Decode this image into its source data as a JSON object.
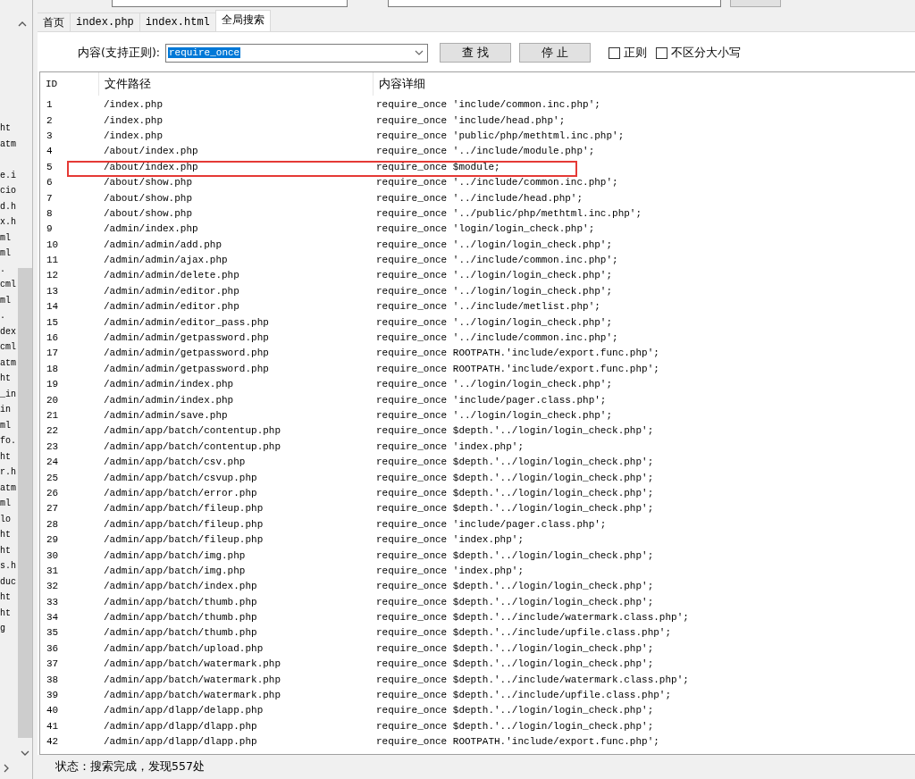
{
  "left_panel": {
    "items": [
      {
        "text": "ht"
      },
      {
        "text": "atm"
      },
      {
        "text": "e.i"
      },
      {
        "text": "cio"
      },
      {
        "text": "d.h"
      },
      {
        "text": "x.h"
      },
      {
        "text": "ml"
      },
      {
        "text": "ml"
      },
      {
        "text": "."
      },
      {
        "text": "cml"
      },
      {
        "text": "ml"
      },
      {
        "text": "."
      },
      {
        "text": "dex"
      },
      {
        "text": "cml"
      },
      {
        "text": "atm"
      },
      {
        "text": "ht"
      },
      {
        "text": "_in"
      },
      {
        "text": "in"
      },
      {
        "text": "ml"
      },
      {
        "text": "fo."
      },
      {
        "text": "ht"
      },
      {
        "text": "r.h"
      },
      {
        "text": "atm"
      },
      {
        "text": "ml"
      },
      {
        "text": "lo"
      },
      {
        "text": "ht"
      },
      {
        "text": "ht"
      },
      {
        "text": "s.h"
      },
      {
        "text": "duc"
      },
      {
        "text": "ht"
      },
      {
        "text": "ht"
      },
      {
        "text": "g"
      }
    ]
  },
  "tabs": [
    {
      "label": "首页",
      "selected": false
    },
    {
      "label": "index.php",
      "selected": false
    },
    {
      "label": "index.html",
      "selected": false
    },
    {
      "label": "全局搜索",
      "selected": true
    }
  ],
  "search": {
    "label": "内容(支持正则):",
    "value": "require_once",
    "buttons": [
      "查 找",
      "停 止"
    ],
    "options": [
      {
        "label": "正则",
        "checked": false
      },
      {
        "label": "不区分大小写",
        "checked": false
      }
    ]
  },
  "table": {
    "columns": [
      "ID",
      "文件路径",
      "内容详细"
    ],
    "rows": [
      {
        "id": "1",
        "path": "/index.php",
        "detail": "require_once 'include/common.inc.php';",
        "highlighted": false
      },
      {
        "id": "2",
        "path": "/index.php",
        "detail": "require_once 'include/head.php';",
        "highlighted": false
      },
      {
        "id": "3",
        "path": "/index.php",
        "detail": "require_once 'public/php/methtml.inc.php';",
        "highlighted": false
      },
      {
        "id": "4",
        "path": "/about/index.php",
        "detail": "require_once '../include/module.php';",
        "highlighted": false
      },
      {
        "id": "5",
        "path": "/about/index.php",
        "detail": "require_once $module;",
        "highlighted": true
      },
      {
        "id": "6",
        "path": "/about/show.php",
        "detail": "require_once '../include/common.inc.php';",
        "highlighted": false
      },
      {
        "id": "7",
        "path": "/about/show.php",
        "detail": "require_once '../include/head.php';",
        "highlighted": false
      },
      {
        "id": "8",
        "path": "/about/show.php",
        "detail": "require_once '../public/php/methtml.inc.php';",
        "highlighted": false
      },
      {
        "id": "9",
        "path": "/admin/index.php",
        "detail": "require_once 'login/login_check.php';",
        "highlighted": false
      },
      {
        "id": "10",
        "path": "/admin/admin/add.php",
        "detail": "require_once '../login/login_check.php';",
        "highlighted": false
      },
      {
        "id": "11",
        "path": "/admin/admin/ajax.php",
        "detail": "require_once '../include/common.inc.php';",
        "highlighted": false
      },
      {
        "id": "12",
        "path": "/admin/admin/delete.php",
        "detail": "require_once '../login/login_check.php';",
        "highlighted": false
      },
      {
        "id": "13",
        "path": "/admin/admin/editor.php",
        "detail": "require_once '../login/login_check.php';",
        "highlighted": false
      },
      {
        "id": "14",
        "path": "/admin/admin/editor.php",
        "detail": "require_once '../include/metlist.php';",
        "highlighted": false
      },
      {
        "id": "15",
        "path": "/admin/admin/editor_pass.php",
        "detail": "require_once '../login/login_check.php';",
        "highlighted": false
      },
      {
        "id": "16",
        "path": "/admin/admin/getpassword.php",
        "detail": "require_once '../include/common.inc.php';",
        "highlighted": false
      },
      {
        "id": "17",
        "path": "/admin/admin/getpassword.php",
        "detail": "require_once ROOTPATH.'include/export.func.php';",
        "highlighted": false
      },
      {
        "id": "18",
        "path": "/admin/admin/getpassword.php",
        "detail": "require_once ROOTPATH.'include/export.func.php';",
        "highlighted": false
      },
      {
        "id": "19",
        "path": "/admin/admin/index.php",
        "detail": "require_once '../login/login_check.php';",
        "highlighted": false
      },
      {
        "id": "20",
        "path": "/admin/admin/index.php",
        "detail": "require_once 'include/pager.class.php';",
        "highlighted": false
      },
      {
        "id": "21",
        "path": "/admin/admin/save.php",
        "detail": "require_once '../login/login_check.php';",
        "highlighted": false
      },
      {
        "id": "22",
        "path": "/admin/app/batch/contentup.php",
        "detail": "require_once $depth.'../login/login_check.php';",
        "highlighted": false
      },
      {
        "id": "23",
        "path": "/admin/app/batch/contentup.php",
        "detail": "require_once 'index.php';",
        "highlighted": false
      },
      {
        "id": "24",
        "path": "/admin/app/batch/csv.php",
        "detail": "require_once $depth.'../login/login_check.php';",
        "highlighted": false
      },
      {
        "id": "25",
        "path": "/admin/app/batch/csvup.php",
        "detail": "require_once $depth.'../login/login_check.php';",
        "highlighted": false
      },
      {
        "id": "26",
        "path": "/admin/app/batch/error.php",
        "detail": "require_once $depth.'../login/login_check.php';",
        "highlighted": false
      },
      {
        "id": "27",
        "path": "/admin/app/batch/fileup.php",
        "detail": "require_once $depth.'../login/login_check.php';",
        "highlighted": false
      },
      {
        "id": "28",
        "path": "/admin/app/batch/fileup.php",
        "detail": "require_once 'include/pager.class.php';",
        "highlighted": false
      },
      {
        "id": "29",
        "path": "/admin/app/batch/fileup.php",
        "detail": "require_once 'index.php';",
        "highlighted": false
      },
      {
        "id": "30",
        "path": "/admin/app/batch/img.php",
        "detail": "require_once $depth.'../login/login_check.php';",
        "highlighted": false
      },
      {
        "id": "31",
        "path": "/admin/app/batch/img.php",
        "detail": "require_once 'index.php';",
        "highlighted": false
      },
      {
        "id": "32",
        "path": "/admin/app/batch/index.php",
        "detail": "require_once $depth.'../login/login_check.php';",
        "highlighted": false
      },
      {
        "id": "33",
        "path": "/admin/app/batch/thumb.php",
        "detail": "require_once $depth.'../login/login_check.php';",
        "highlighted": false
      },
      {
        "id": "34",
        "path": "/admin/app/batch/thumb.php",
        "detail": "require_once $depth.'../include/watermark.class.php';",
        "highlighted": false
      },
      {
        "id": "35",
        "path": "/admin/app/batch/thumb.php",
        "detail": "require_once $depth.'../include/upfile.class.php';",
        "highlighted": false
      },
      {
        "id": "36",
        "path": "/admin/app/batch/upload.php",
        "detail": "require_once $depth.'../login/login_check.php';",
        "highlighted": false
      },
      {
        "id": "37",
        "path": "/admin/app/batch/watermark.php",
        "detail": "require_once $depth.'../login/login_check.php';",
        "highlighted": false
      },
      {
        "id": "38",
        "path": "/admin/app/batch/watermark.php",
        "detail": "require_once $depth.'../include/watermark.class.php';",
        "highlighted": false
      },
      {
        "id": "39",
        "path": "/admin/app/batch/watermark.php",
        "detail": "require_once $depth.'../include/upfile.class.php';",
        "highlighted": false
      },
      {
        "id": "40",
        "path": "/admin/app/dlapp/delapp.php",
        "detail": "require_once $depth.'../login/login_check.php';",
        "highlighted": false
      },
      {
        "id": "41",
        "path": "/admin/app/dlapp/dlapp.php",
        "detail": "require_once $depth.'../login/login_check.php';",
        "highlighted": false
      },
      {
        "id": "42",
        "path": "/admin/app/dlapp/dlapp.php",
        "detail": "require_once ROOTPATH.'include/export.func.php';",
        "highlighted": false
      }
    ]
  },
  "status_bar": {
    "text": "状态：搜索完成，发现557处"
  }
}
